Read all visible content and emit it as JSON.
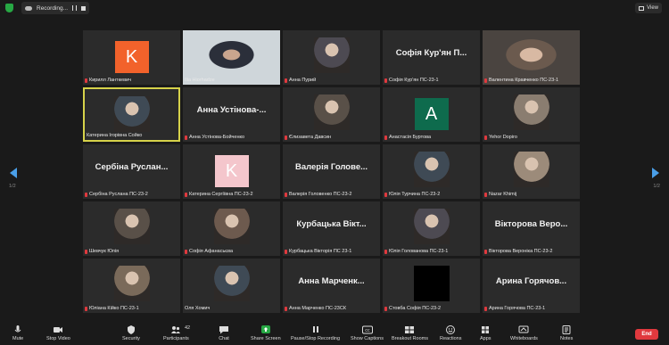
{
  "topbar": {
    "recording_label": "Recording...",
    "view_label": "View"
  },
  "pager": {
    "left": "1/2",
    "right": "1/2"
  },
  "tiles": [
    {
      "name": "Кирилл Ланткевич",
      "type": "avatar",
      "letter": "K",
      "color": "#f2622b",
      "muted": true
    },
    {
      "name": "Ilia Hiorhadze",
      "type": "video",
      "muted": false
    },
    {
      "name": "Анна Пурий",
      "type": "photo",
      "muted": true
    },
    {
      "name": "Софія Кур'ян ПС-23-1",
      "type": "text",
      "big": "Софія Кур'ян П...",
      "muted": true
    },
    {
      "name": "Валентина Кравченко ПС-23-1",
      "type": "video",
      "muted": true
    },
    {
      "name": "Катерина Ігорівна Сойко",
      "type": "photo",
      "muted": false,
      "active": true
    },
    {
      "name": "Анна Устінова-Бойченко",
      "type": "text",
      "big": "Анна Устінова-...",
      "muted": true
    },
    {
      "name": "Єлизавета Давсин",
      "type": "photo",
      "muted": true
    },
    {
      "name": "Анастасія Буртова",
      "type": "avatar",
      "letter": "A",
      "color": "#0e6b4d",
      "muted": true
    },
    {
      "name": "Yehor Dopiro",
      "type": "photo",
      "muted": true
    },
    {
      "name": "Сербіна Руслана ПС-23-2",
      "type": "text",
      "big": "Сербіна Руслан...",
      "muted": true
    },
    {
      "name": "Катерина Сергіївна ПС-23-2",
      "type": "avatar",
      "letter": "K",
      "color": "#f4c6cc",
      "muted": true
    },
    {
      "name": "Валерія Головенко ПС-23-2",
      "type": "text",
      "big": "Валерія Голове...",
      "muted": true
    },
    {
      "name": "Юлія Турчина ПС-23-2",
      "type": "photo",
      "muted": true
    },
    {
      "name": "Nazar Khimij",
      "type": "photo",
      "muted": true
    },
    {
      "name": "Шевчук Юлія",
      "type": "photo",
      "muted": true
    },
    {
      "name": "Софія Афанасьєва",
      "type": "photo",
      "muted": true
    },
    {
      "name": "Курбацька Вікторія ПС 23-1",
      "type": "text",
      "big": "Курбацька Вікт...",
      "muted": true
    },
    {
      "name": "Юлія Голованова ПС-23-1",
      "type": "photo",
      "muted": true
    },
    {
      "name": "Вікторова Вероніка ПС-23-2",
      "type": "text",
      "big": "Вікторова Веро...",
      "muted": true
    },
    {
      "name": "Юліана Кійко ПС-23-1",
      "type": "photo",
      "muted": true
    },
    {
      "name": "Оля Хомич",
      "type": "photo",
      "muted": false
    },
    {
      "name": "Анна Марченко ПС-23СК",
      "type": "text",
      "big": "Анна Марченк...",
      "muted": true
    },
    {
      "name": "Стовба Софія ПС-23-2",
      "type": "black",
      "muted": true
    },
    {
      "name": "Арина Горячова ПС-23-1",
      "type": "text",
      "big": "Арина Горячов...",
      "muted": true
    }
  ],
  "toolbar": {
    "mute": "Mute",
    "stop_video": "Stop Video",
    "security": "Security",
    "participants": "Participants",
    "participants_count": "42",
    "chat": "Chat",
    "share_screen": "Share Screen",
    "record": "Pause/Stop Recording",
    "captions": "Show Captions",
    "breakout": "Breakout Rooms",
    "reactions": "Reactions",
    "apps": "Apps",
    "whiteboards": "Whiteboards",
    "notes": "Notes",
    "end": "End"
  },
  "colors": {
    "active_border": "#d6d24a",
    "end": "#e0393e",
    "share": "#27a844",
    "nav_arrow": "#4a9fe8"
  }
}
